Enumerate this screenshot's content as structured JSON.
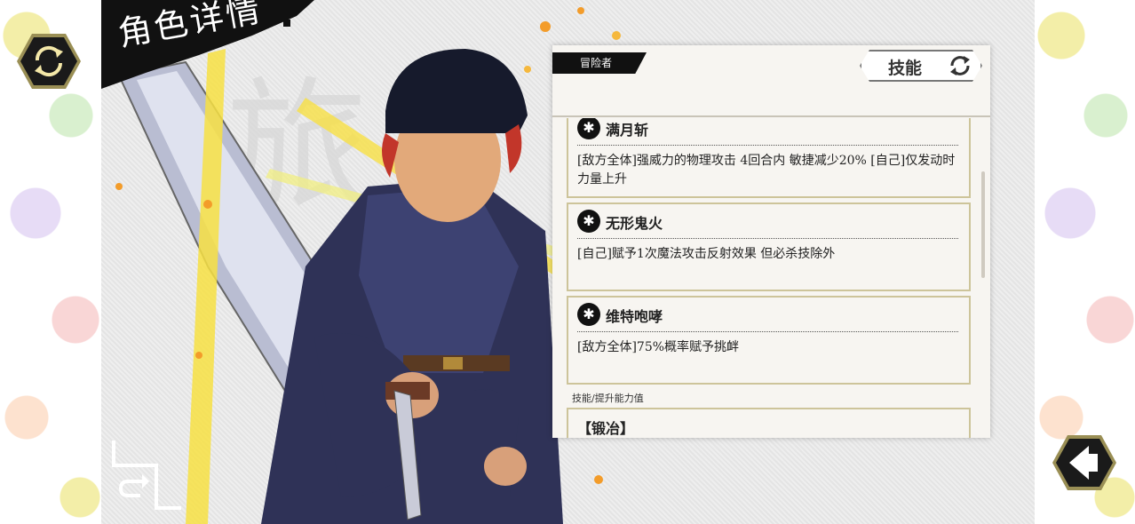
{
  "page_title": "角色详情",
  "card": {
    "role_tag": "冒险者",
    "skill_tab_label": "技能"
  },
  "skills": [
    {
      "name": "满月斩",
      "desc": "[敌方全体]强威力的物理攻击 4回合内 敏捷减少20% [自己]仅发动时力量上升"
    },
    {
      "name": "无形鬼火",
      "desc": "[自己]赋予1次魔法攻击反射效果 但必杀技除外"
    },
    {
      "name": "维特咆哮",
      "desc": "[敌方全体]75%概率赋予挑衅"
    }
  ],
  "ability_section": {
    "label": "技能/提升能力值",
    "first_item": "【锻冶】"
  },
  "icons": {
    "top_left": "refresh-icon",
    "bottom_right": "back-arrow-icon",
    "skill_tab": "refresh-icon",
    "corner": "return-icon",
    "skill": "asterisk-icon"
  },
  "colors": {
    "card_border": "#cdc49a",
    "banner": "#111111",
    "accent_yellow": "#f7e043"
  }
}
